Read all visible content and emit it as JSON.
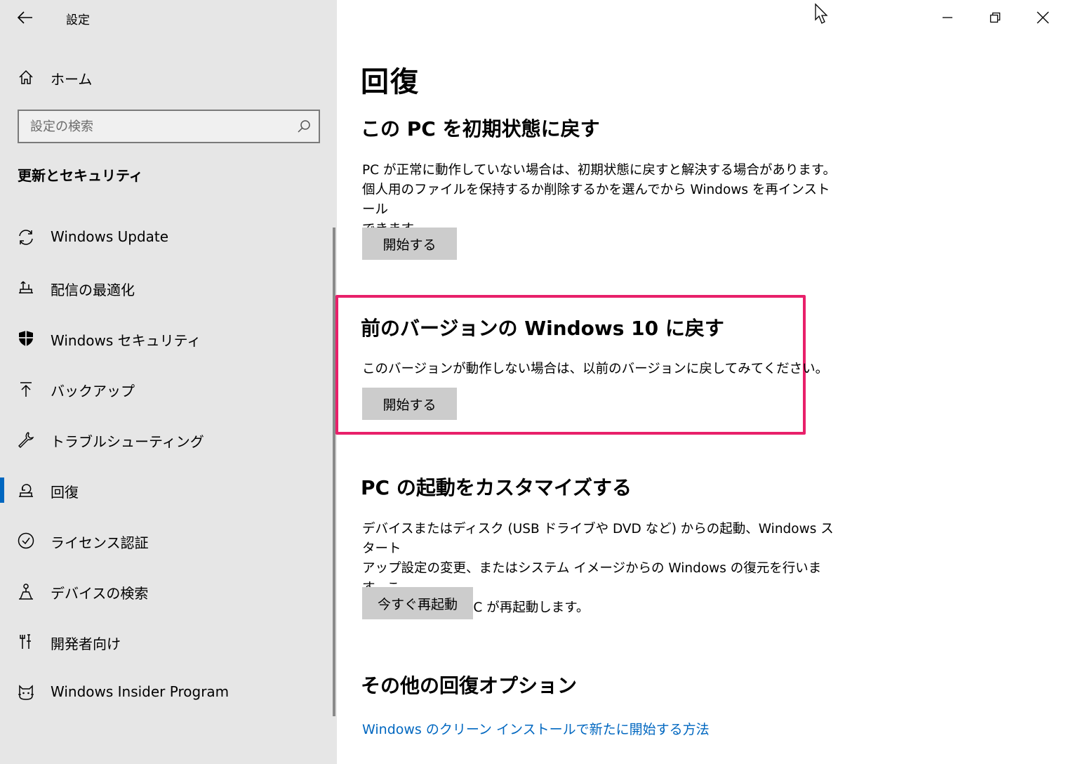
{
  "window": {
    "title": "設定",
    "accent": "#0067c0",
    "highlight_color": "#e8206a"
  },
  "sidebar": {
    "home_label": "ホーム",
    "search_placeholder": "設定の検索",
    "section_header": "更新とセキュリティ",
    "items": [
      {
        "label": "Windows Update",
        "icon": "sync-icon",
        "selected": false
      },
      {
        "label": "配信の最適化",
        "icon": "delivery-optimization-icon",
        "selected": false
      },
      {
        "label": "Windows セキュリティ",
        "icon": "shield-icon",
        "selected": false
      },
      {
        "label": "バックアップ",
        "icon": "backup-arrow-icon",
        "selected": false
      },
      {
        "label": "トラブルシューティング",
        "icon": "wrench-icon",
        "selected": false
      },
      {
        "label": "回復",
        "icon": "recovery-icon",
        "selected": true
      },
      {
        "label": "ライセンス認証",
        "icon": "check-circle-icon",
        "selected": false
      },
      {
        "label": "デバイスの検索",
        "icon": "find-device-icon",
        "selected": false
      },
      {
        "label": "開発者向け",
        "icon": "developer-tools-icon",
        "selected": false
      },
      {
        "label": "Windows Insider Program",
        "icon": "insider-cat-icon",
        "selected": false
      }
    ]
  },
  "main": {
    "page_title": "回復",
    "reset": {
      "heading": "この PC を初期状態に戻す",
      "description_lines": [
        "PC が正常に動作していない場合は、初期状態に戻すと解決する場合があります。",
        "個人用のファイルを保持するか削除するかを選んでから Windows を再インストール",
        "できます。"
      ],
      "button": "開始する"
    },
    "go_back": {
      "heading": "前のバージョンの Windows 10 に戻す",
      "description": "このバージョンが動作しない場合は、以前のバージョンに戻してみてください。",
      "button": "開始する"
    },
    "advanced_startup": {
      "heading": "PC の起動をカスタマイズする",
      "description_lines": [
        "デバイスまたはディスク (USB ドライブや DVD など) からの起動、Windows スタート",
        "アップ設定の変更、またはシステム イメージからの Windows の復元を行います。こ",
        "の操作を行うと、PC が再起動します。"
      ],
      "button": "今すぐ再起動"
    },
    "more_options": {
      "heading": "その他の回復オプション",
      "link": "Windows のクリーン インストールで新たに開始する方法"
    }
  }
}
